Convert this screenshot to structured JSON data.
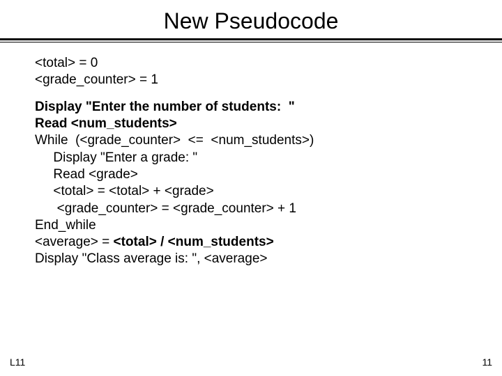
{
  "title": "New Pseudocode",
  "init": {
    "l1": "<total> = 0",
    "l2": "<grade_counter> = 1"
  },
  "code": {
    "l1a": "Display \"Enter the number of students:  \"",
    "l1b": "Read <num_students>",
    "l2": "While  (<grade_counter>  <=  <num_students>)",
    "l3": "     Display \"Enter a grade: \"",
    "l4": "     Read <grade>",
    "l5": "     <total> = <total> + <grade>",
    "l6": "      <grade_counter> = <grade_counter> + 1",
    "l7": "End_while",
    "l8a": "<average> = ",
    "l8b": "<total> / <num_students>",
    "l9": "Display \"Class average is: \", <average>"
  },
  "footer": {
    "left": "L11",
    "right": "11"
  }
}
